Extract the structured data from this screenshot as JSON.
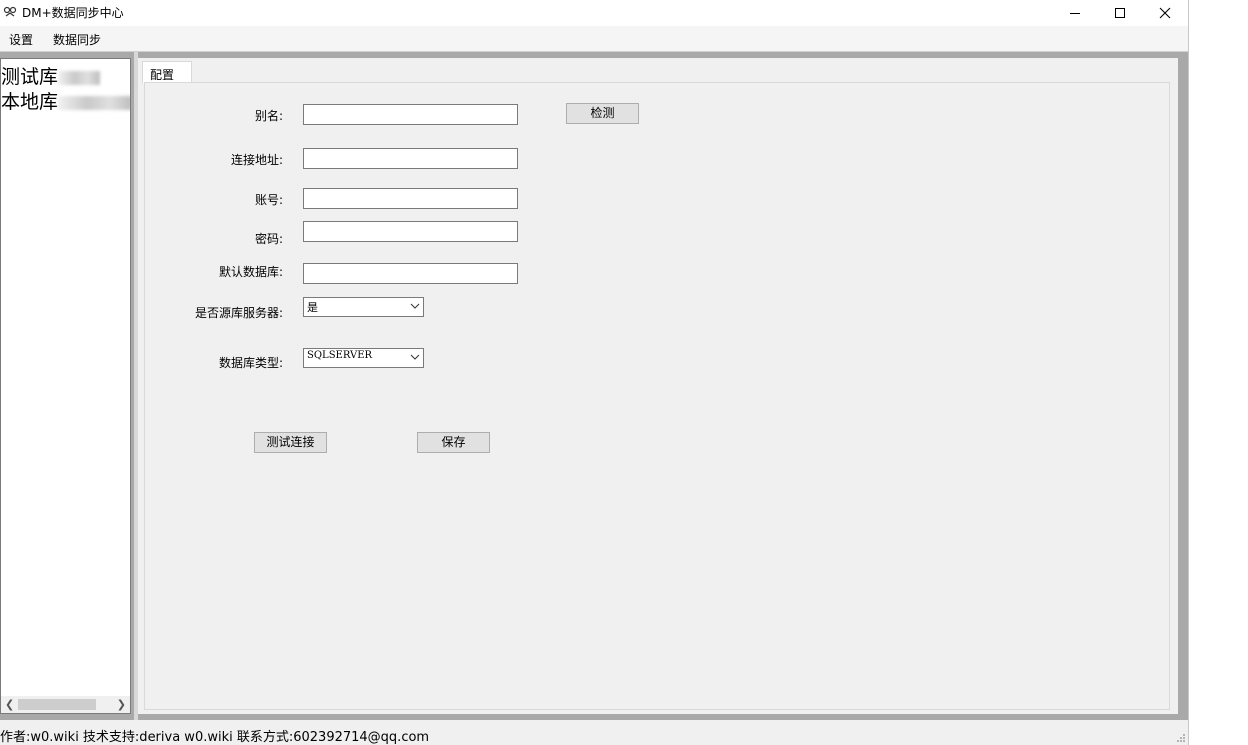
{
  "window": {
    "title": "DM+数据同步中心"
  },
  "menu": {
    "items": [
      "设置",
      "数据同步"
    ]
  },
  "tree": {
    "nodes": [
      "测试库",
      "本地库"
    ]
  },
  "tabs": {
    "active": "配置"
  },
  "form": {
    "alias_label": "别名:",
    "alias_value": "",
    "check_button": "检测",
    "address_label": "连接地址:",
    "address_value": "",
    "account_label": "账号:",
    "account_value": "",
    "password_label": "密码:",
    "password_value": "",
    "default_db_label": "默认数据库:",
    "default_db_value": "",
    "source_server_label": "是否源库服务器:",
    "source_server_value": "是",
    "db_type_label": "数据库类型:",
    "db_type_value": "SQLSERVER",
    "test_button": "测试连接",
    "save_button": "保存"
  },
  "status": {
    "text": "作者:w0.wiki  技术支持:deriva  w0.wiki  联系方式:602392714@qq.com"
  }
}
